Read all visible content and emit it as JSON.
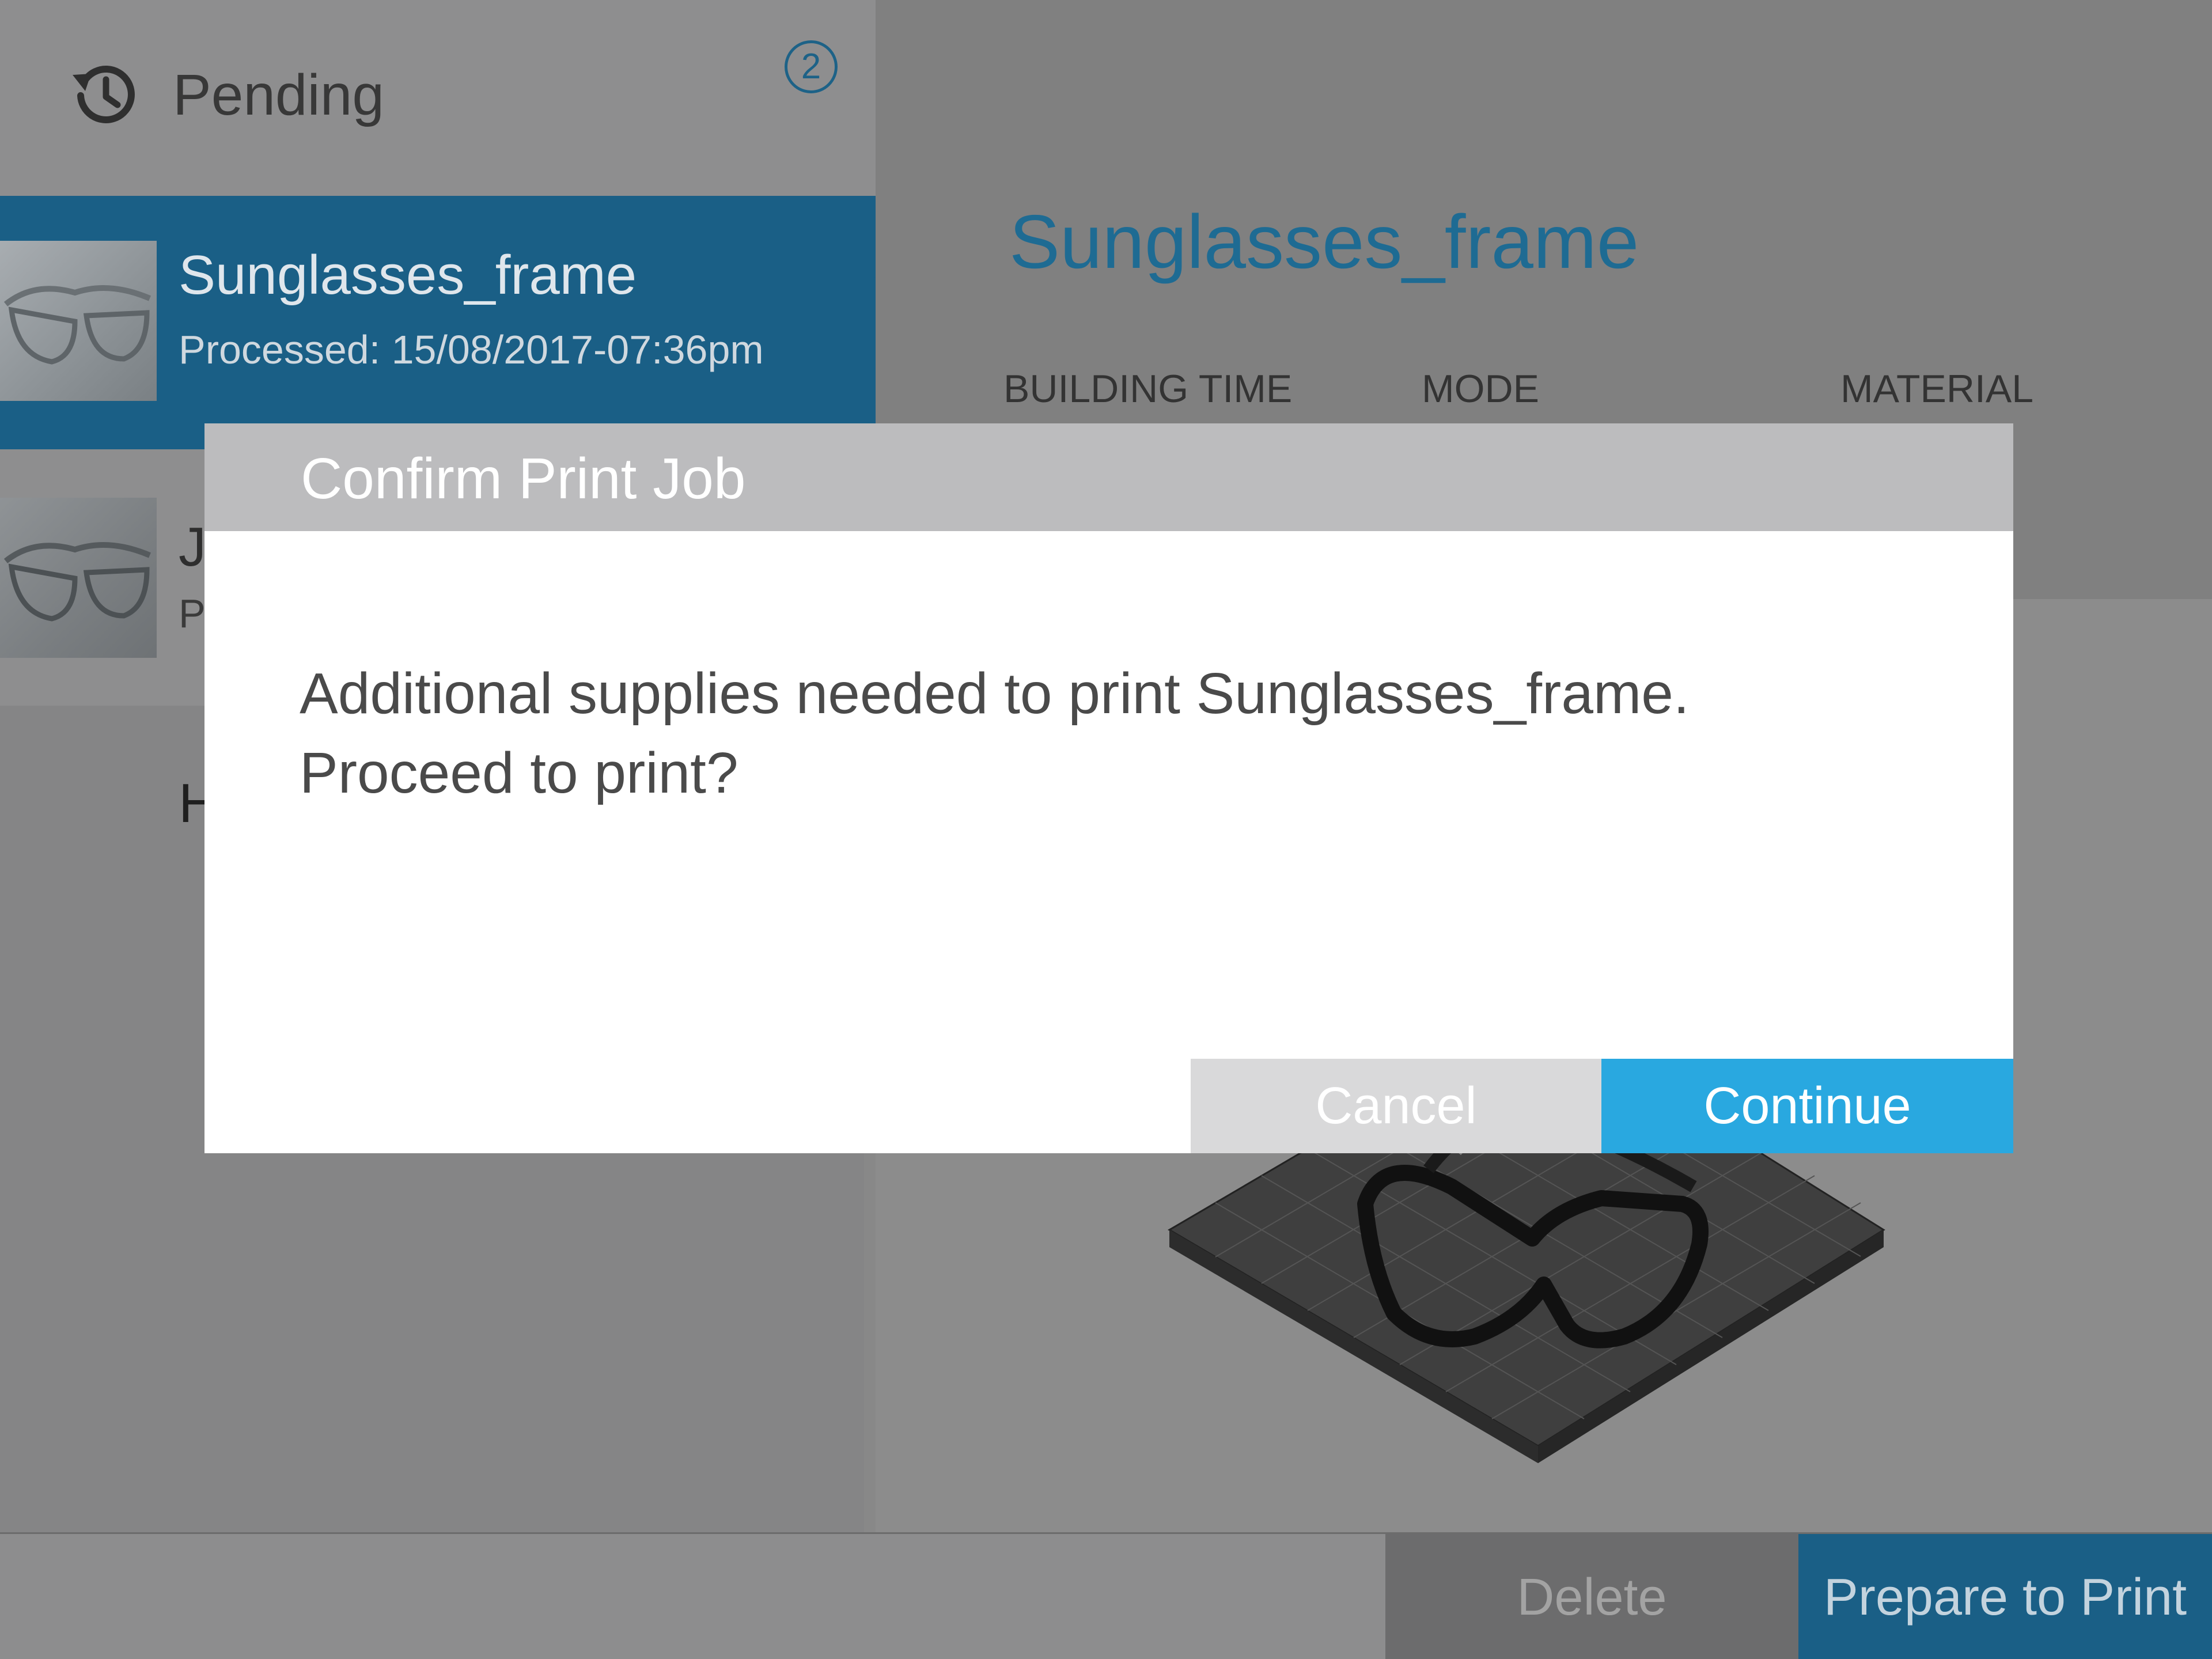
{
  "sidebar": {
    "header": {
      "title": "Pending",
      "count": "2",
      "icon": "history-icon"
    },
    "jobs": [
      {
        "name": "Sunglasses_frame",
        "status": "Processed: 15/08/2017-07:36pm",
        "selected": true
      },
      {
        "name": "J",
        "status": "P",
        "selected": false
      }
    ],
    "history_title": "H"
  },
  "detail": {
    "title": "Sunglasses_frame",
    "columns": [
      "BUILDING TIME",
      "MODE",
      "MATERIAL"
    ]
  },
  "toolbar": {
    "delete_label": "Delete",
    "prepare_label": "Prepare to Print"
  },
  "modal": {
    "title": "Confirm Print Job",
    "message_line1": "Additional supplies needed to print Sunglasses_frame.",
    "message_line2": "Proceed to print?",
    "cancel_label": "Cancel",
    "continue_label": "Continue"
  },
  "colors": {
    "accent": "#1a5f86",
    "continue": "#29a8e0",
    "title_blue": "#1e6b93"
  }
}
